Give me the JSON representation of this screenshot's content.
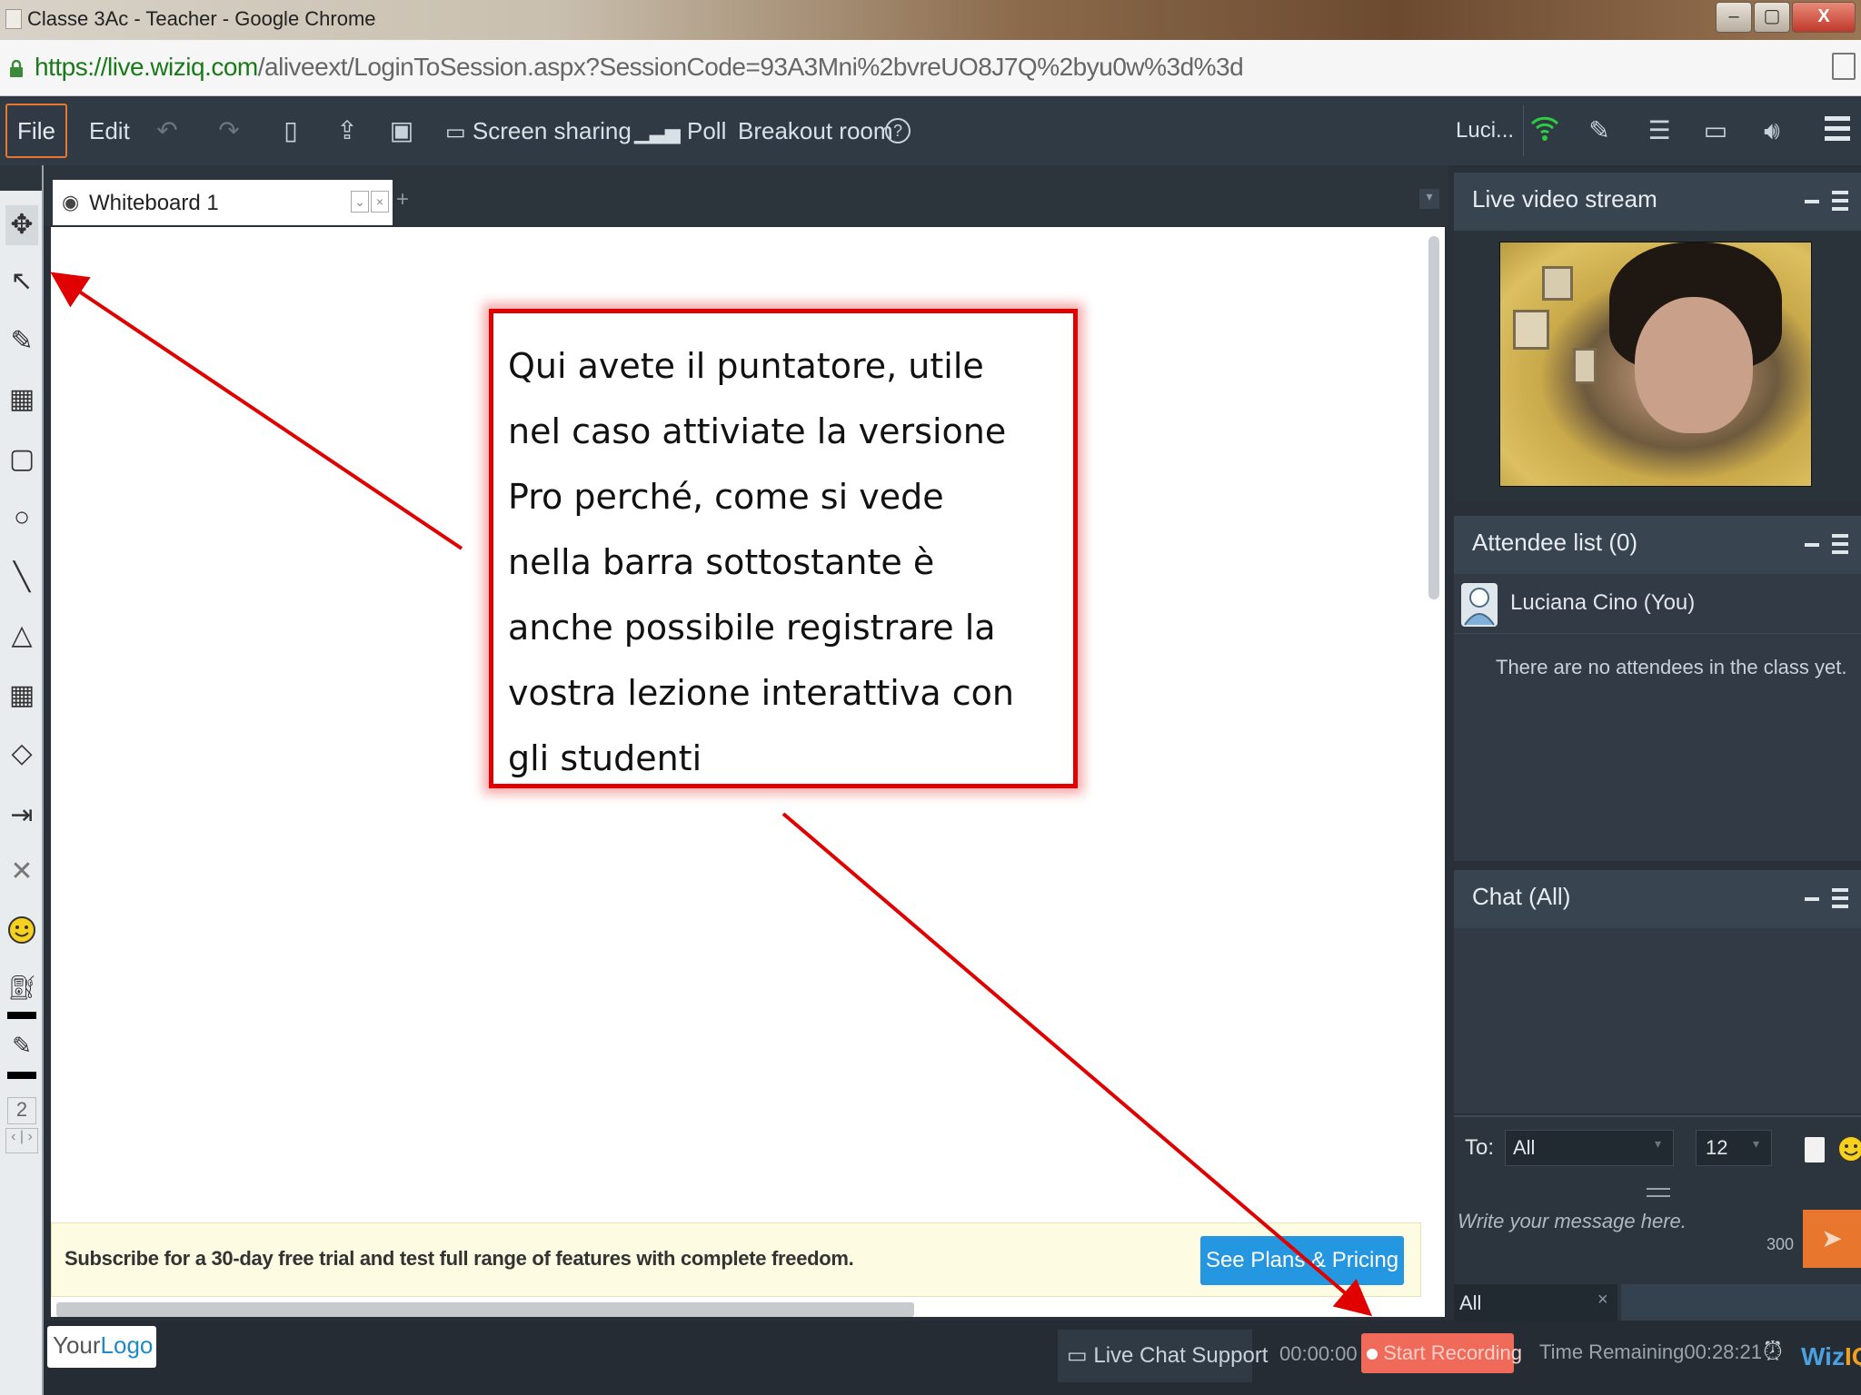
{
  "window": {
    "title": "Classe 3Ac - Teacher - Google Chrome",
    "controls": [
      "–",
      "▢",
      "X"
    ]
  },
  "address_bar": {
    "url_prefix": "https://live.wiziq.com",
    "url_rest": "/aliveext/LoginToSession.aspx?SessionCode=93A3Mni%2bvreUO8J7Q%2byu0w%3d%3d"
  },
  "toolbar": {
    "file": "File",
    "edit": "Edit",
    "screen_sharing": "Screen sharing",
    "poll": "Poll",
    "breakout_room": "Breakout room",
    "help": "?",
    "user": "Luci..."
  },
  "left_tools": {
    "page_number": "2",
    "page_nav": "‹ | ›"
  },
  "whiteboard": {
    "tab_label": "Whiteboard 1",
    "add_tab": "+",
    "promo_text": "Subscribe for a 30-day free trial and test full range of features with complete freedom.",
    "promo_button": "See Plans & Pricing"
  },
  "callout": {
    "lines": [
      "Qui avete il puntatore, utile",
      "nel caso attiviate la versione",
      "Pro perché, come si vede",
      "nella barra sottostante è",
      "anche possibile registrare la",
      "vostra lezione interattiva con",
      "gli studenti"
    ]
  },
  "panels": {
    "video": {
      "title": "Live video stream"
    },
    "attendees": {
      "title": "Attendee list (0)",
      "me": "Luciana Cino (You)",
      "empty": "There are no attendees in the class yet."
    },
    "chat": {
      "title": "Chat (All)",
      "to_label": "To:",
      "to_value": "All",
      "font_size": "12",
      "placeholder": "Write your message here.",
      "char_count": "300",
      "filter": "All",
      "filter_clear": "×"
    }
  },
  "status_bar": {
    "logo_your": "Your",
    "logo_logo": "Logo",
    "live_chat": "Live Chat Support",
    "timer": "00:00:00",
    "start_recording": "Start Recording",
    "time_remaining_label": "Time Remaining",
    "time_remaining": "00:28:21",
    "brand_wiz": "Wiz",
    "brand_iq": "IQ"
  },
  "colors": {
    "accent_orange": "#e8762c",
    "callout_red": "#e00000",
    "promo_button": "#2596e0",
    "record_button": "#f06a5a"
  }
}
